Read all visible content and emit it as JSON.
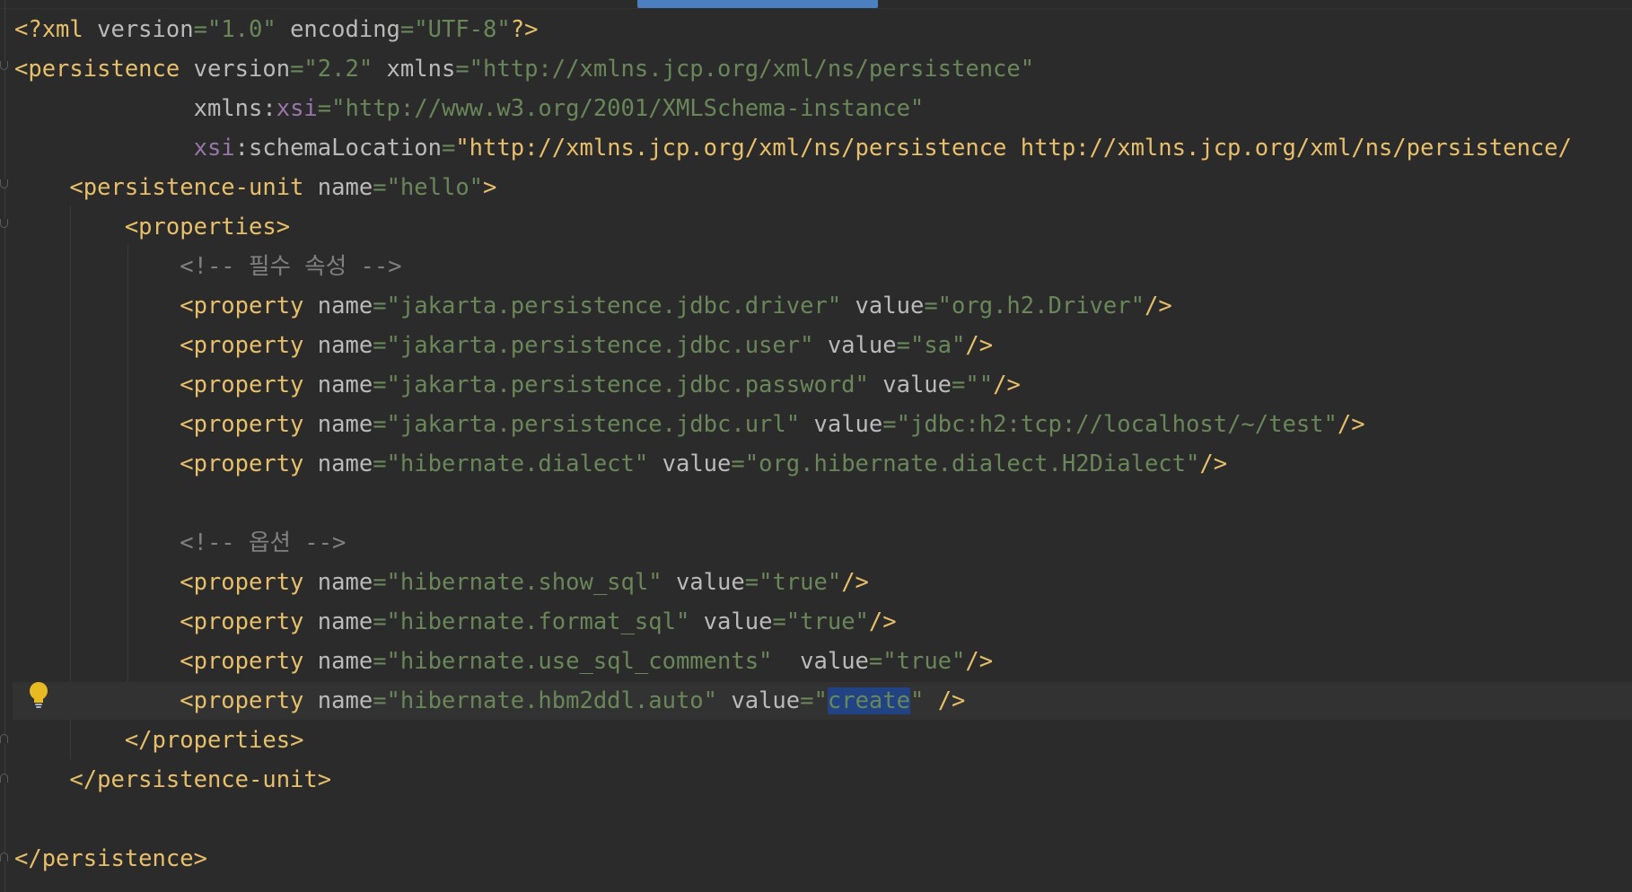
{
  "editor": {
    "lines": [
      "<?xml version=\"1.0\" encoding=\"UTF-8\"?>",
      "<persistence version=\"2.2\" xmlns=\"http://xmlns.jcp.org/xml/ns/persistence\"",
      "             xmlns:xsi=\"http://www.w3.org/2001/XMLSchema-instance\"",
      "             xsi:schemaLocation=\"http://xmlns.jcp.org/xml/ns/persistence http://xmlns.jcp.org/xml/ns/persistence/",
      "    <persistence-unit name=\"hello\">",
      "        <properties>",
      "            <!-- 필수 속성 -->",
      "            <property name=\"jakarta.persistence.jdbc.driver\" value=\"org.h2.Driver\"/>",
      "            <property name=\"jakarta.persistence.jdbc.user\" value=\"sa\"/>",
      "            <property name=\"jakarta.persistence.jdbc.password\" value=\"\"/>",
      "            <property name=\"jakarta.persistence.jdbc.url\" value=\"jdbc:h2:tcp://localhost/~/test\"/>",
      "            <property name=\"hibernate.dialect\" value=\"org.hibernate.dialect.H2Dialect\"/>",
      "",
      "            <!-- 옵션 -->",
      "            <property name=\"hibernate.show_sql\" value=\"true\"/>",
      "            <property name=\"hibernate.format_sql\" value=\"true\"/>",
      "            <property name=\"hibernate.use_sql_comments\"  value=\"true\"/>",
      "            <property name=\"hibernate.hbm2ddl.auto\" value=\"create\" />",
      "        </properties>",
      "    </persistence-unit>",
      "",
      "</persistence>"
    ],
    "current_line": 18,
    "selection": "create",
    "colors": {
      "background": "#2b2b2b",
      "tag": "#e8bf6a",
      "attribute": "#bababa",
      "string": "#6a8759",
      "namespace": "#9876aa",
      "comment": "#808080",
      "selection": "#214283",
      "current_line": "#323232"
    },
    "gutter_icon": "lightbulb-icon"
  }
}
